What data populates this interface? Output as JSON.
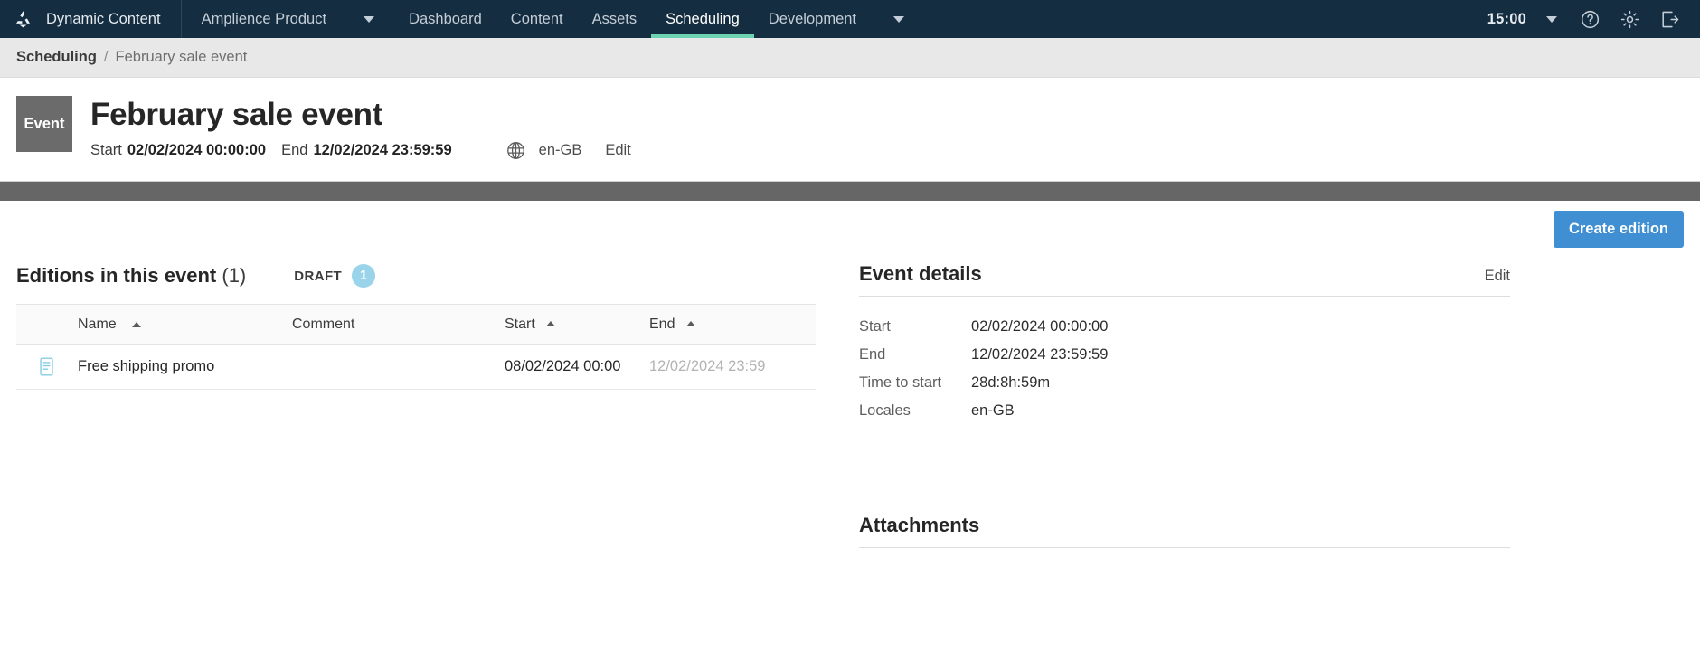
{
  "topnav": {
    "logo_icon": "amplience-logo-icon",
    "brand": "Dynamic Content",
    "hub_label": "Amplience Product",
    "hub_caret_icon": "chevron-down-icon",
    "items": [
      {
        "label": "Dashboard",
        "active": false
      },
      {
        "label": "Content",
        "active": false
      },
      {
        "label": "Assets",
        "active": false
      },
      {
        "label": "Scheduling",
        "active": true
      },
      {
        "label": "Development",
        "active": false
      }
    ],
    "overflow_caret_icon": "chevron-down-icon",
    "clock": "15:00",
    "clock_caret_icon": "chevron-down-icon",
    "help_icon": "help-circle-icon",
    "settings_icon": "gear-icon",
    "logout_icon": "logout-icon"
  },
  "breadcrumb": {
    "root": "Scheduling",
    "separator": "/",
    "current": "February sale event"
  },
  "event_header": {
    "badge": "Event",
    "title": "February sale event",
    "start_label": "Start",
    "start_value": "02/02/2024 00:00:00",
    "end_label": "End",
    "end_value": "12/02/2024 23:59:59",
    "globe_icon": "globe-icon",
    "locale": "en-GB",
    "edit_label": "Edit"
  },
  "toolbar": {
    "create_edition_label": "Create edition"
  },
  "editions": {
    "section_title": "Editions in this event",
    "section_count": "(1)",
    "draft_label": "DRAFT",
    "draft_count": "1",
    "columns": {
      "name": "Name",
      "comment": "Comment",
      "start": "Start",
      "end": "End"
    },
    "sort_icon": "sort-ascending-icon",
    "rows": [
      {
        "icon": "edition-document-icon",
        "name": "Free shipping promo",
        "comment": "",
        "start": "08/02/2024 00:00",
        "end": "12/02/2024 23:59"
      }
    ]
  },
  "event_details": {
    "title": "Event details",
    "edit_label": "Edit",
    "rows": [
      {
        "key": "Start",
        "value": "02/02/2024 00:00:00"
      },
      {
        "key": "End",
        "value": "12/02/2024 23:59:59"
      },
      {
        "key": "Time to start",
        "value": "28d:8h:59m"
      },
      {
        "key": "Locales",
        "value": "en-GB"
      }
    ]
  },
  "attachments": {
    "title": "Attachments"
  },
  "colors": {
    "nav_bg": "#152d40",
    "active_underline": "#6bd3b0",
    "primary_button": "#3f8fd2",
    "draft_badge": "#9ad4ea",
    "grey_bar": "#666666",
    "event_tile": "#6b6b6b"
  }
}
